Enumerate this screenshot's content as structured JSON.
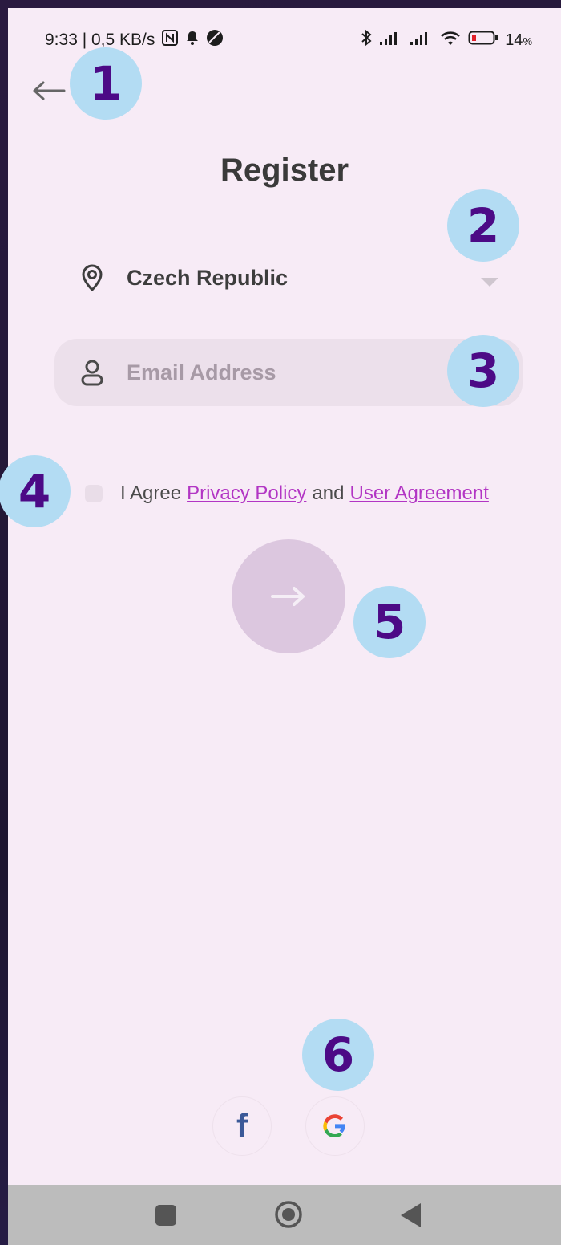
{
  "status_bar": {
    "time_speed": "9:33 | 0,5 KB/s",
    "battery_pct": "14",
    "battery_unit": "%"
  },
  "page": {
    "title": "Register"
  },
  "country": {
    "name": "Czech Republic"
  },
  "email": {
    "placeholder": "Email Address",
    "value": ""
  },
  "agreement": {
    "prefix": "I Agree",
    "privacy_link": "Privacy Policy",
    "conjunction": "and",
    "user_link": "User Agreement",
    "checked": false
  },
  "annotations": [
    "1",
    "2",
    "3",
    "4",
    "5",
    "6"
  ],
  "colors": {
    "accent": "#b235c4",
    "badge": "#b3dcf3",
    "badge_text": "#4c0a86"
  }
}
